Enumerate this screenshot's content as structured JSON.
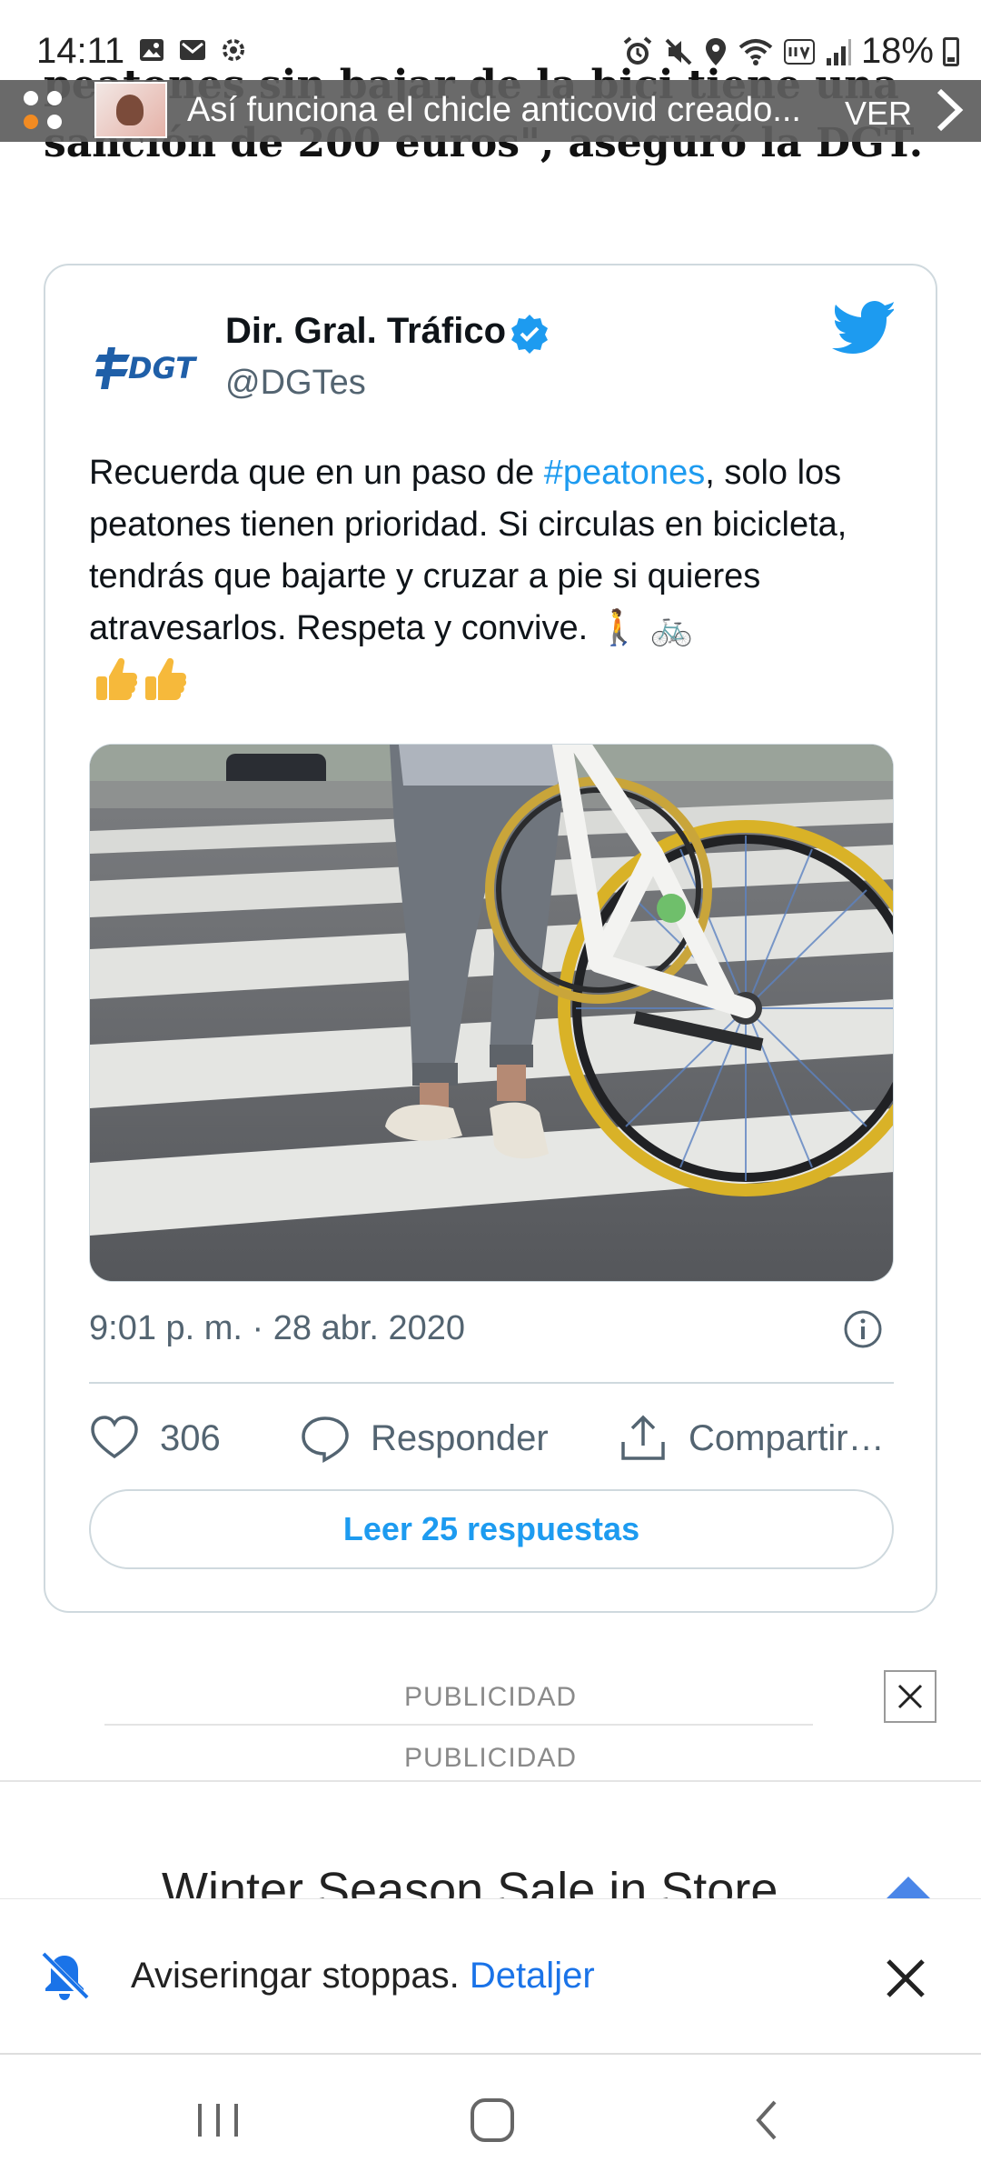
{
  "status_bar": {
    "time": "14:11",
    "battery": "18%",
    "left_icons": [
      "gallery-icon",
      "mail-icon",
      "settings-icon"
    ],
    "right_icons": [
      "alarm-icon",
      "mute-icon",
      "location-icon",
      "wifi-icon",
      "volte-icon",
      "signal-icon",
      "battery-icon"
    ]
  },
  "article": {
    "headline_hidden_line": "peatones sin bajar de la bici tiene una",
    "headline_last_line": "sanción de 200 euros\", aseguró la DGT."
  },
  "news_banner": {
    "text": "Así funciona el chicle anticovid creado...",
    "action": "VER"
  },
  "tweet": {
    "author_name": "Dir. Gral. Tráfico",
    "author_handle": "@DGTes",
    "logo_text": "DGT",
    "text_before": "Recuerda que en un paso de ",
    "hashtag": "#peatones",
    "text_after": ", solo los peatones tienen prioridad. Si circulas en bicicleta, tendrás que bajarte y cruzar a pie si quieres atravesarlos. Respeta y convive.",
    "emoji_line": "🚶 🚲",
    "timestamp": "9:01 p. m. · 28 abr. 2020",
    "likes": "306",
    "reply_label": "Responder",
    "share_label": "Compartir…",
    "read_replies": "Leer 25 respuestas"
  },
  "ads": {
    "label_1": "PUBLICIDAD",
    "label_2": "PUBLICIDAD",
    "headline": "Winter Season Sale in Store"
  },
  "notification": {
    "text": "Aviseringar stoppas.",
    "link": "Detaljer"
  },
  "colors": {
    "twitter_blue": "#1d9bf0",
    "link_blue": "#1a73e8",
    "banner_bg": "#5f5f5f",
    "dgt_blue": "#1f5fa8"
  }
}
